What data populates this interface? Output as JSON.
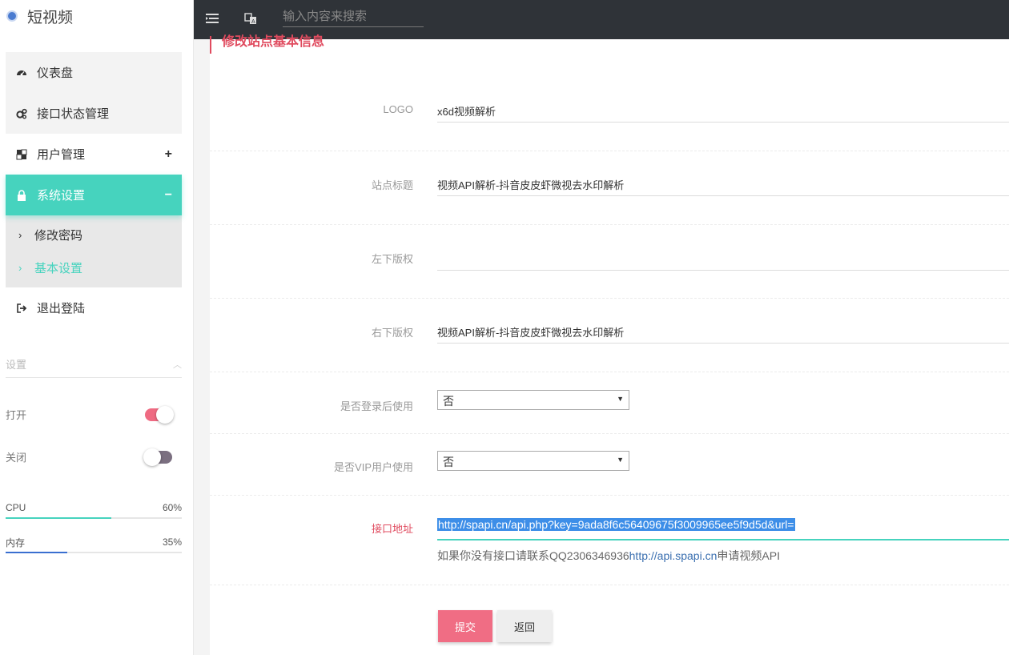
{
  "brand": {
    "title": "短视频",
    "icon": "app-logo-icon"
  },
  "topbar": {
    "menu_icon": "menu-toggle-icon",
    "translate_icon": "translate-icon",
    "search_placeholder": "输入内容来搜索"
  },
  "sidebar": {
    "items": [
      {
        "label": "仪表盘",
        "icon": "dashboard-icon"
      },
      {
        "label": "接口状态管理",
        "icon": "cogs-icon"
      },
      {
        "label": "用户管理",
        "icon": "users-icon",
        "expand": "+"
      },
      {
        "label": "系统设置",
        "icon": "lock-icon",
        "expand": "−",
        "active": true
      },
      {
        "label": "退出登陆",
        "icon": "logout-icon"
      }
    ],
    "submenu": [
      {
        "label": "修改密码"
      },
      {
        "label": "基本设置",
        "active": true
      }
    ],
    "settings": {
      "title": "设置",
      "toggles": [
        {
          "label": "打开",
          "on": true
        },
        {
          "label": "关闭",
          "on": false
        }
      ]
    },
    "stats": [
      {
        "label": "CPU",
        "percent_text": "60%",
        "percent": 60,
        "color": "#46d3be"
      },
      {
        "label": "内存",
        "percent_text": "35%",
        "percent": 35,
        "color": "#3a6fd0"
      }
    ]
  },
  "main": {
    "title": "修改站点基本信息",
    "fields": {
      "logo": {
        "label": "LOGO",
        "value": "x6d视频解析"
      },
      "site_title": {
        "label": "站点标题",
        "value": "视频API解析-抖音皮皮虾微视去水印解析"
      },
      "copyright_left": {
        "label": "左下版权",
        "value": ""
      },
      "copyright_right": {
        "label": "右下版权",
        "value": "视频API解析-抖音皮皮虾微视去水印解析"
      },
      "login_required": {
        "label": "是否登录后使用",
        "value": "否"
      },
      "vip_required": {
        "label": "是否VIP用户使用",
        "value": "否"
      },
      "api_url": {
        "label": "接口地址",
        "value": "http://spapi.cn/api.php?key=9ada8f6c56409675f3009965ee5f9d5d&url=",
        "help_prefix": "如果你没有接口请联系QQ2306346936",
        "help_link": "http://api.spapi.cn",
        "help_suffix": "申请视频API"
      }
    },
    "buttons": {
      "submit": "提交",
      "back": "返回"
    }
  },
  "colors": {
    "accent": "#46d3be",
    "danger": "#e04b5f",
    "primary_button": "#f06d84",
    "topbar": "#2f3338"
  }
}
